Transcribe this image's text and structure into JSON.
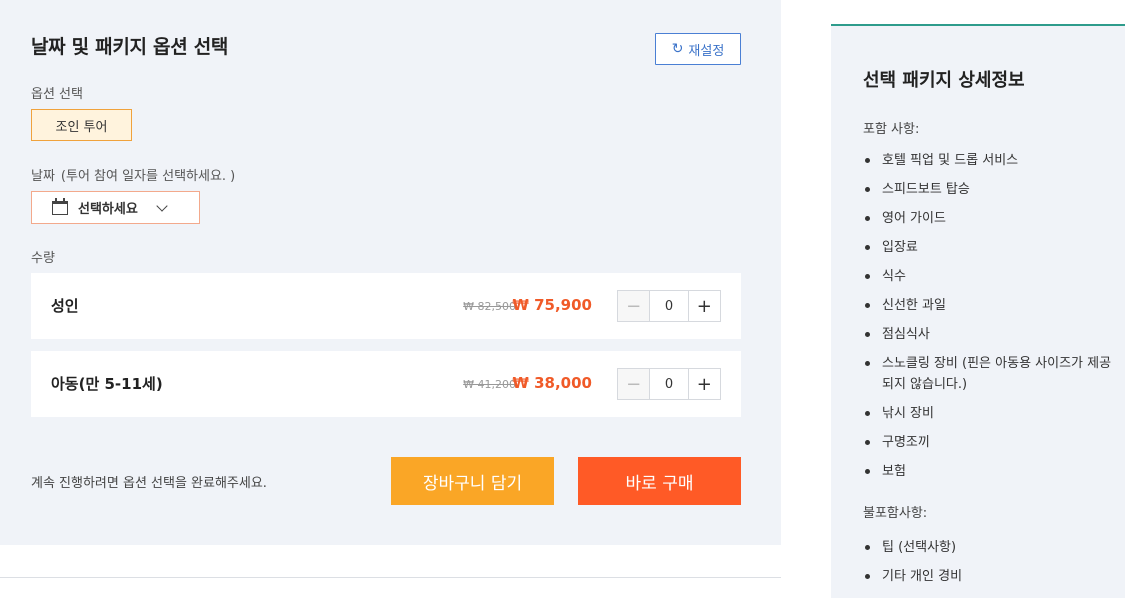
{
  "booking": {
    "title": "날짜 및 패키지 옵션 선택",
    "reset_label": "재설정",
    "option_label": "옵션 선택",
    "option_selected": "조인 투어",
    "date_label": "날짜",
    "date_hint": "(투어 참여 일자를 선택하세요. )",
    "date_placeholder": "선택하세요",
    "quantity_label": "수량",
    "rows": [
      {
        "name": "성인",
        "original_price": "₩ 82,500",
        "price": "₩ 75,900",
        "qty": "0"
      },
      {
        "name": "아동(만 5-11세)",
        "original_price": "₩ 41,200",
        "price": "₩ 38,000",
        "qty": "0"
      }
    ],
    "notice": "계속 진행하려면 옵션 선택을 완료해주세요.",
    "cart_label": "장바구니 담기",
    "buy_label": "바로 구매"
  },
  "details": {
    "title": "선택 패키지 상세정보",
    "included_label": "포함 사항:",
    "included": [
      "호텔 픽업 및 드롭 서비스",
      "스피드보트 탑승",
      "영어 가이드",
      "입장료",
      "식수",
      "신선한 과일",
      "점심식사",
      "스노클링 장비 (핀은 아동용 사이즈가 제공되지 않습니다.)",
      "낚시 장비",
      "구명조끼",
      "보험"
    ],
    "excluded_label": "불포함사항:",
    "excluded": [
      "팁 (선택사항)",
      "기타 개인 경비"
    ]
  },
  "colors": {
    "accent_orange": "#ff5a26",
    "cart_orange": "#faa626",
    "price_red": "#f05a28",
    "reset_blue": "#3b73c9",
    "teal_border": "#2e9c8c"
  }
}
